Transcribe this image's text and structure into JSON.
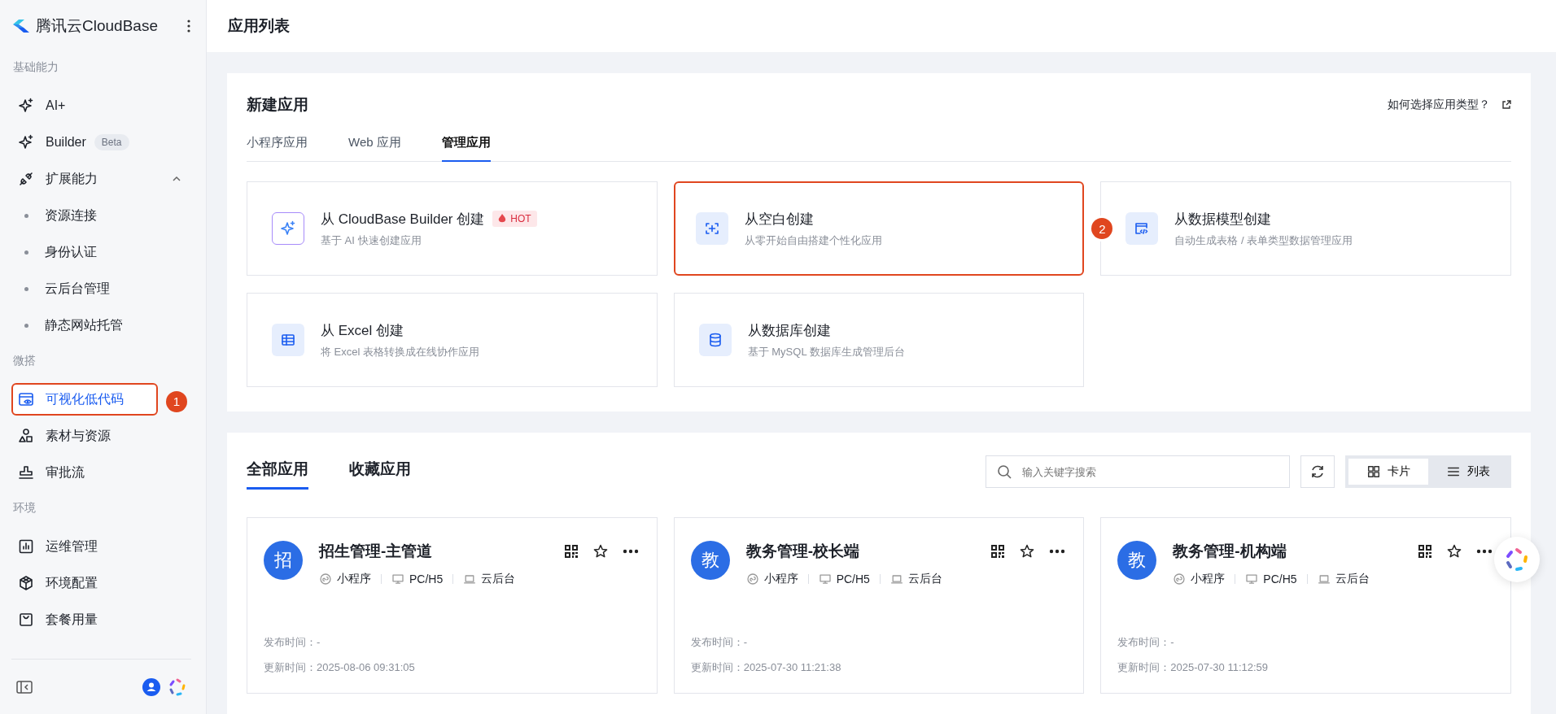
{
  "sidebar": {
    "brand": "腾讯云CloudBase",
    "sections": [
      {
        "heading": "基础能力",
        "items": [
          {
            "label": "AI+",
            "kind": "sparkle",
            "selected": false
          },
          {
            "label": "Builder",
            "kind": "sparkle",
            "badge": "Beta",
            "selected": false
          },
          {
            "label": "扩展能力",
            "kind": "plug",
            "selected": false,
            "expanded": true,
            "children": [
              {
                "label": "资源连接",
                "selected": false
              },
              {
                "label": "身份认证",
                "selected": false
              },
              {
                "label": "云后台管理",
                "selected": false
              },
              {
                "label": "静态网站托管",
                "selected": false
              }
            ]
          }
        ]
      },
      {
        "heading": "微搭",
        "items": [
          {
            "label": "可视化低代码",
            "kind": "eye-window",
            "selected": true,
            "annotation": "1"
          },
          {
            "label": "素材与资源",
            "kind": "shapes",
            "selected": false
          },
          {
            "label": "审批流",
            "kind": "stamp",
            "selected": false
          }
        ]
      },
      {
        "heading": "环境",
        "items": [
          {
            "label": "运维管理",
            "kind": "chart",
            "selected": false
          },
          {
            "label": "环境配置",
            "kind": "cube",
            "selected": false
          },
          {
            "label": "套餐用量",
            "kind": "bag",
            "selected": false
          }
        ]
      }
    ]
  },
  "header": {
    "title": "应用列表"
  },
  "create_panel": {
    "title": "新建应用",
    "help_link": "如何选择应用类型？",
    "tabs": [
      {
        "label": "小程序应用",
        "selected": false
      },
      {
        "label": "Web 应用",
        "selected": false
      },
      {
        "label": "管理应用",
        "selected": true
      }
    ],
    "options": [
      {
        "kind": "sparkle",
        "title": "从 CloudBase Builder 创建",
        "badge": "HOT",
        "description": "基于 AI 快速创建应用"
      },
      {
        "kind": "frame-plus",
        "title": "从空白创建",
        "description": "从零开始自由搭建个性化应用",
        "annotation": "2"
      },
      {
        "kind": "code-window",
        "title": "从数据模型创建",
        "description": "自动生成表格 / 表单类型数据管理应用"
      },
      {
        "kind": "table",
        "title": "从 Excel 创建",
        "description": "将 Excel 表格转换成在线协作应用"
      },
      {
        "kind": "database",
        "title": "从数据库创建",
        "description": "基于 MySQL 数据库生成管理后台"
      }
    ]
  },
  "apps_panel": {
    "tabs": [
      {
        "label": "全部应用",
        "selected": true
      },
      {
        "label": "收藏应用",
        "selected": false
      }
    ],
    "search": {
      "placeholder": "输入关键字搜索"
    },
    "view_modes": [
      {
        "label": "卡片",
        "kind": "grid",
        "selected": true
      },
      {
        "label": "列表",
        "kind": "list",
        "selected": false
      }
    ],
    "apps": [
      {
        "avatar": "招",
        "name": "招生管理-主管道",
        "platforms": [
          {
            "kind": "miniprogram",
            "label": "小程序"
          },
          {
            "kind": "desktop",
            "label": "PC/H5"
          },
          {
            "kind": "laptop",
            "label": "云后台"
          }
        ],
        "publish_label": "发布时间：",
        "publish_time": "-",
        "update_label": "更新时间：",
        "update_time": "2025-08-06 09:31:05"
      },
      {
        "avatar": "教",
        "name": "教务管理-校长端",
        "platforms": [
          {
            "kind": "miniprogram",
            "label": "小程序"
          },
          {
            "kind": "desktop",
            "label": "PC/H5"
          },
          {
            "kind": "laptop",
            "label": "云后台"
          }
        ],
        "publish_label": "发布时间：",
        "publish_time": "-",
        "update_label": "更新时间：",
        "update_time": "2025-07-30 11:21:38"
      },
      {
        "avatar": "教",
        "name": "教务管理-机构端",
        "platforms": [
          {
            "kind": "miniprogram",
            "label": "小程序"
          },
          {
            "kind": "desktop",
            "label": "PC/H5"
          },
          {
            "kind": "laptop",
            "label": "云后台"
          }
        ],
        "publish_label": "发布时间：",
        "publish_time": "-",
        "update_label": "更新时间：",
        "update_time": "2025-07-30 11:12:59"
      }
    ]
  }
}
